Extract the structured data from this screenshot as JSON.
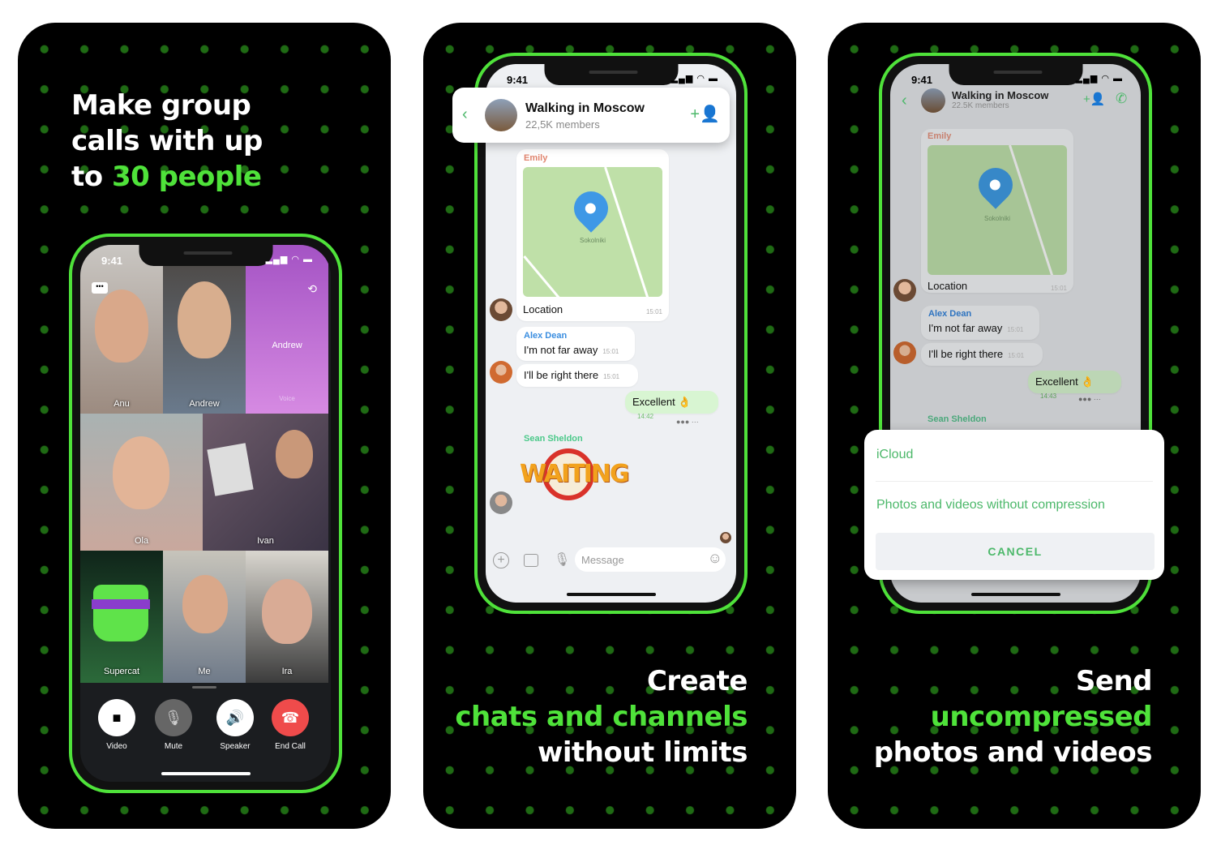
{
  "colors": {
    "accent": "#4fe23a",
    "app_green": "#4cb86a",
    "end_call": "#ef4b4b"
  },
  "panel1": {
    "headline": [
      "Make group",
      "calls with up"
    ],
    "headline_prefix": "to ",
    "headline_highlight": "30 people",
    "status_time": "9:41",
    "participants": [
      {
        "name": "Anu"
      },
      {
        "name": "Andrew"
      },
      {
        "name": "Andrew",
        "subtitle": "Voice"
      },
      {
        "name": "Ola"
      },
      {
        "name": "Ivan"
      },
      {
        "name": "Supercat"
      },
      {
        "name": "Me"
      },
      {
        "name": "Ira"
      }
    ],
    "controls": [
      {
        "label": "Video",
        "icon": "video-camera-icon"
      },
      {
        "label": "Mute",
        "icon": "microphone-muted-icon"
      },
      {
        "label": "Speaker",
        "icon": "speaker-icon"
      },
      {
        "label": "End Call",
        "icon": "end-call-icon"
      }
    ]
  },
  "panel2": {
    "status_time": "9:41",
    "chat": {
      "title": "Walking in Moscow",
      "subtitle": "22,5K members"
    },
    "messages": {
      "emily": {
        "sender": "Emily",
        "map_label": "Sokolniki",
        "text": "Location",
        "time": "15:01"
      },
      "alex1": {
        "sender": "Alex Dean",
        "text": "I'm not far away",
        "time": "15:01"
      },
      "alex2": {
        "text": "I'll be right there",
        "time": "15:01"
      },
      "mine": {
        "text": "Excellent 👌",
        "time": "14:42"
      },
      "sean": {
        "sender": "Sean Sheldon",
        "sticker": "WAITING"
      }
    },
    "composer_placeholder": "Message",
    "caption": {
      "line1": "Create",
      "line2": "chats and channels",
      "line3": "without limits"
    }
  },
  "panel3": {
    "status_time": "9:41",
    "chat": {
      "title": "Walking in Moscow",
      "subtitle": "22.5K members"
    },
    "messages": {
      "emily": {
        "sender": "Emily",
        "map_label": "Sokolniki",
        "text": "Location",
        "time": "15:01"
      },
      "alex1": {
        "sender": "Alex Dean",
        "text": "I'm not far away",
        "time": "15:01"
      },
      "alex2": {
        "text": "I'll be right there",
        "time": "15:01"
      },
      "mine": {
        "text": "Excellent 👌",
        "time": "14:43"
      },
      "sean": {
        "sender": "Sean Sheldon"
      }
    },
    "sheet": {
      "option1": "iCloud",
      "option2": "Photos and videos without compression",
      "cancel": "CANCEL"
    },
    "caption": {
      "line1": "Send",
      "line2": "uncompressed",
      "line3": "photos and videos"
    }
  }
}
